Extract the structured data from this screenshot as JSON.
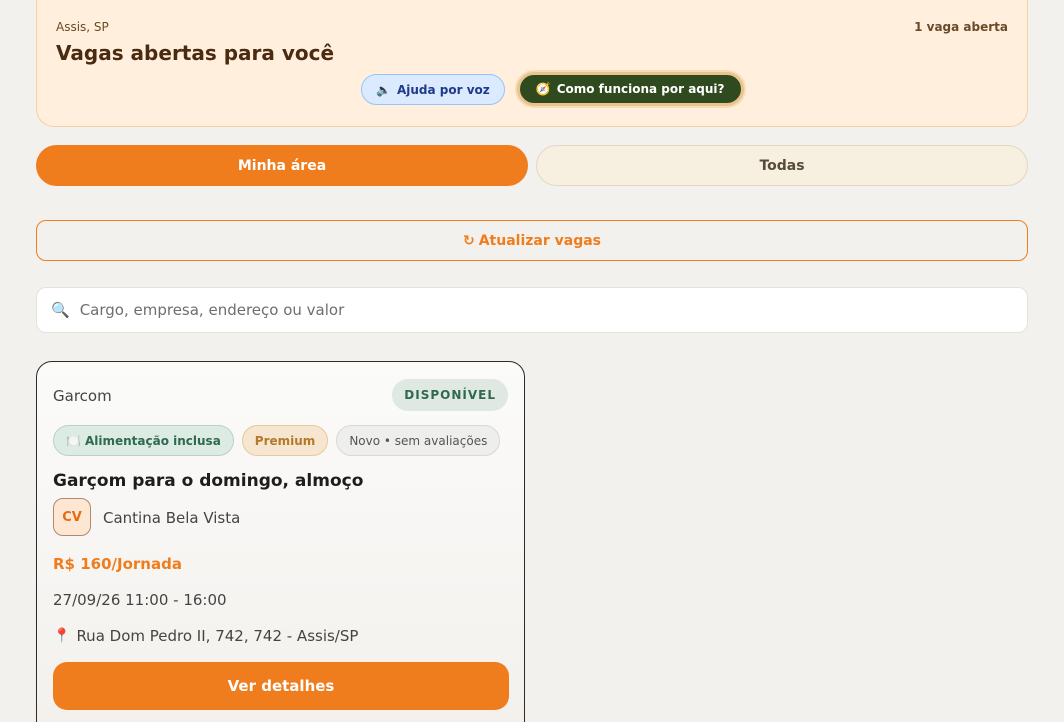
{
  "header": {
    "location": "Assis, SP",
    "open_count": "1 vaga aberta",
    "title": "Vagas abertas para você",
    "voice_help_label": "Ajuda por voz",
    "voice_icon": "speaker-icon",
    "how_it_works_label": "Como funciona por aqui?",
    "how_icon": "compass-icon"
  },
  "tabs": [
    {
      "label": "Minha área",
      "active": true
    },
    {
      "label": "Todas",
      "active": false
    }
  ],
  "refresh": {
    "icon": "↻",
    "label": "Atualizar vagas"
  },
  "search": {
    "placeholder": "Cargo, empresa, endereço ou valor",
    "icon": "magnifier-icon"
  },
  "jobs": [
    {
      "role": "Garcom",
      "status": "DISPONÍVEL",
      "chips": {
        "food": "Alimentação inclusa",
        "premium": "Premium",
        "rating": "Novo • sem avaliações"
      },
      "title": "Garçom para o domingo, almoço",
      "company_initials": "CV",
      "company": "Cantina Bela Vista",
      "pay": "R$ 160/Jornada",
      "datetime": "27/09/26 11:00 - 16:00",
      "address": "Rua Dom Pedro II, 742, 742 - Assis/SP",
      "details_label": "Ver detalhes"
    }
  ],
  "colors": {
    "accent": "#ef7d1e",
    "hero_bg": "#ffefdc",
    "how_button": "#2f4a1e",
    "available": "#2f6a4f"
  }
}
